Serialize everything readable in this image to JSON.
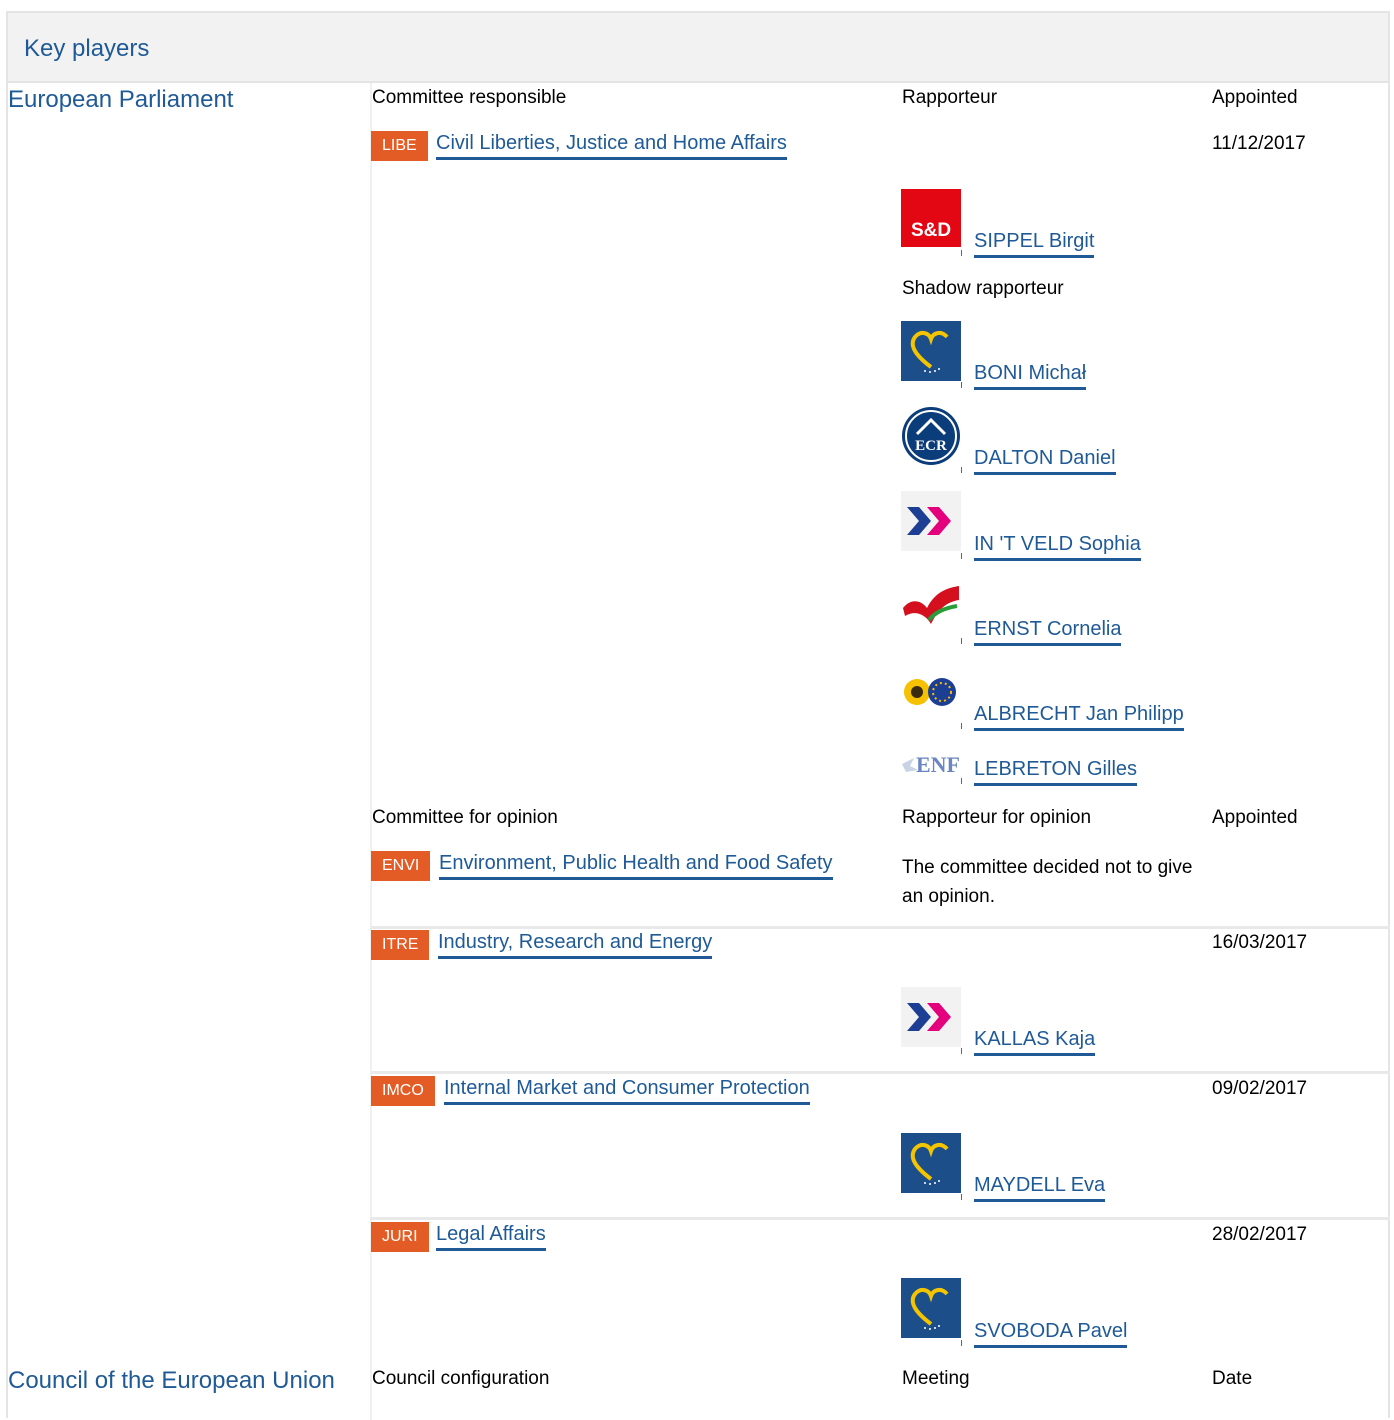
{
  "header": {
    "title": "Key players"
  },
  "sections": {
    "ep": "European Parliament",
    "council": "Council of the European Union"
  },
  "columns": {
    "committee_responsible": "Committee responsible",
    "rapporteur": "Rapporteur",
    "appointed": "Appointed",
    "shadow_rapporteur": "Shadow rapporteur",
    "committee_opinion": "Committee for opinion",
    "rapporteur_opinion": "Rapporteur for opinion",
    "appointed2": "Appointed",
    "council_config": "Council configuration",
    "meeting": "Meeting",
    "date": "Date"
  },
  "responsible": {
    "badge": "LIBE",
    "name": "Civil Liberties, Justice and Home Affairs",
    "appointed": "11/12/2017",
    "rapporteur": {
      "group": "S&D",
      "name": "SIPPEL Birgit"
    },
    "shadows": [
      {
        "group_icon": "epp-heart-logo",
        "name": "BONI Michał"
      },
      {
        "group_icon": "ecr-logo",
        "name": "DALTON Daniel"
      },
      {
        "group_icon": "alde-arrows-logo",
        "name": "IN 'T VELD Sophia"
      },
      {
        "group_icon": "gue-flag-logo",
        "name": "ERNST Cornelia"
      },
      {
        "group_icon": "greens-efa-logo",
        "name": "ALBRECHT Jan Philipp"
      },
      {
        "group_icon": "enf-logo",
        "group_text": "ENF",
        "name": "LEBRETON Gilles"
      }
    ]
  },
  "opinions": [
    {
      "badge": "ENVI",
      "name": "Environment, Public Health and Food Safety",
      "note": "The committee decided not to give an opinion."
    },
    {
      "badge": "ITRE",
      "name": "Industry, Research and Energy",
      "appointed": "16/03/2017",
      "rapporteur": "KALLAS Kaja",
      "group_icon": "alde-arrows-logo"
    },
    {
      "badge": "IMCO",
      "name": "Internal Market and Consumer Protection",
      "appointed": "09/02/2017",
      "rapporteur": "MAYDELL Eva",
      "group_icon": "epp-heart-logo"
    },
    {
      "badge": "JURI",
      "name": "Legal Affairs",
      "appointed": "28/02/2017",
      "rapporteur": "SVOBODA Pavel",
      "group_icon": "epp-heart-logo"
    }
  ],
  "colors": {
    "link": "#1f5a96",
    "badge": "#e35c25",
    "header_bg": "#f2f2f2"
  }
}
